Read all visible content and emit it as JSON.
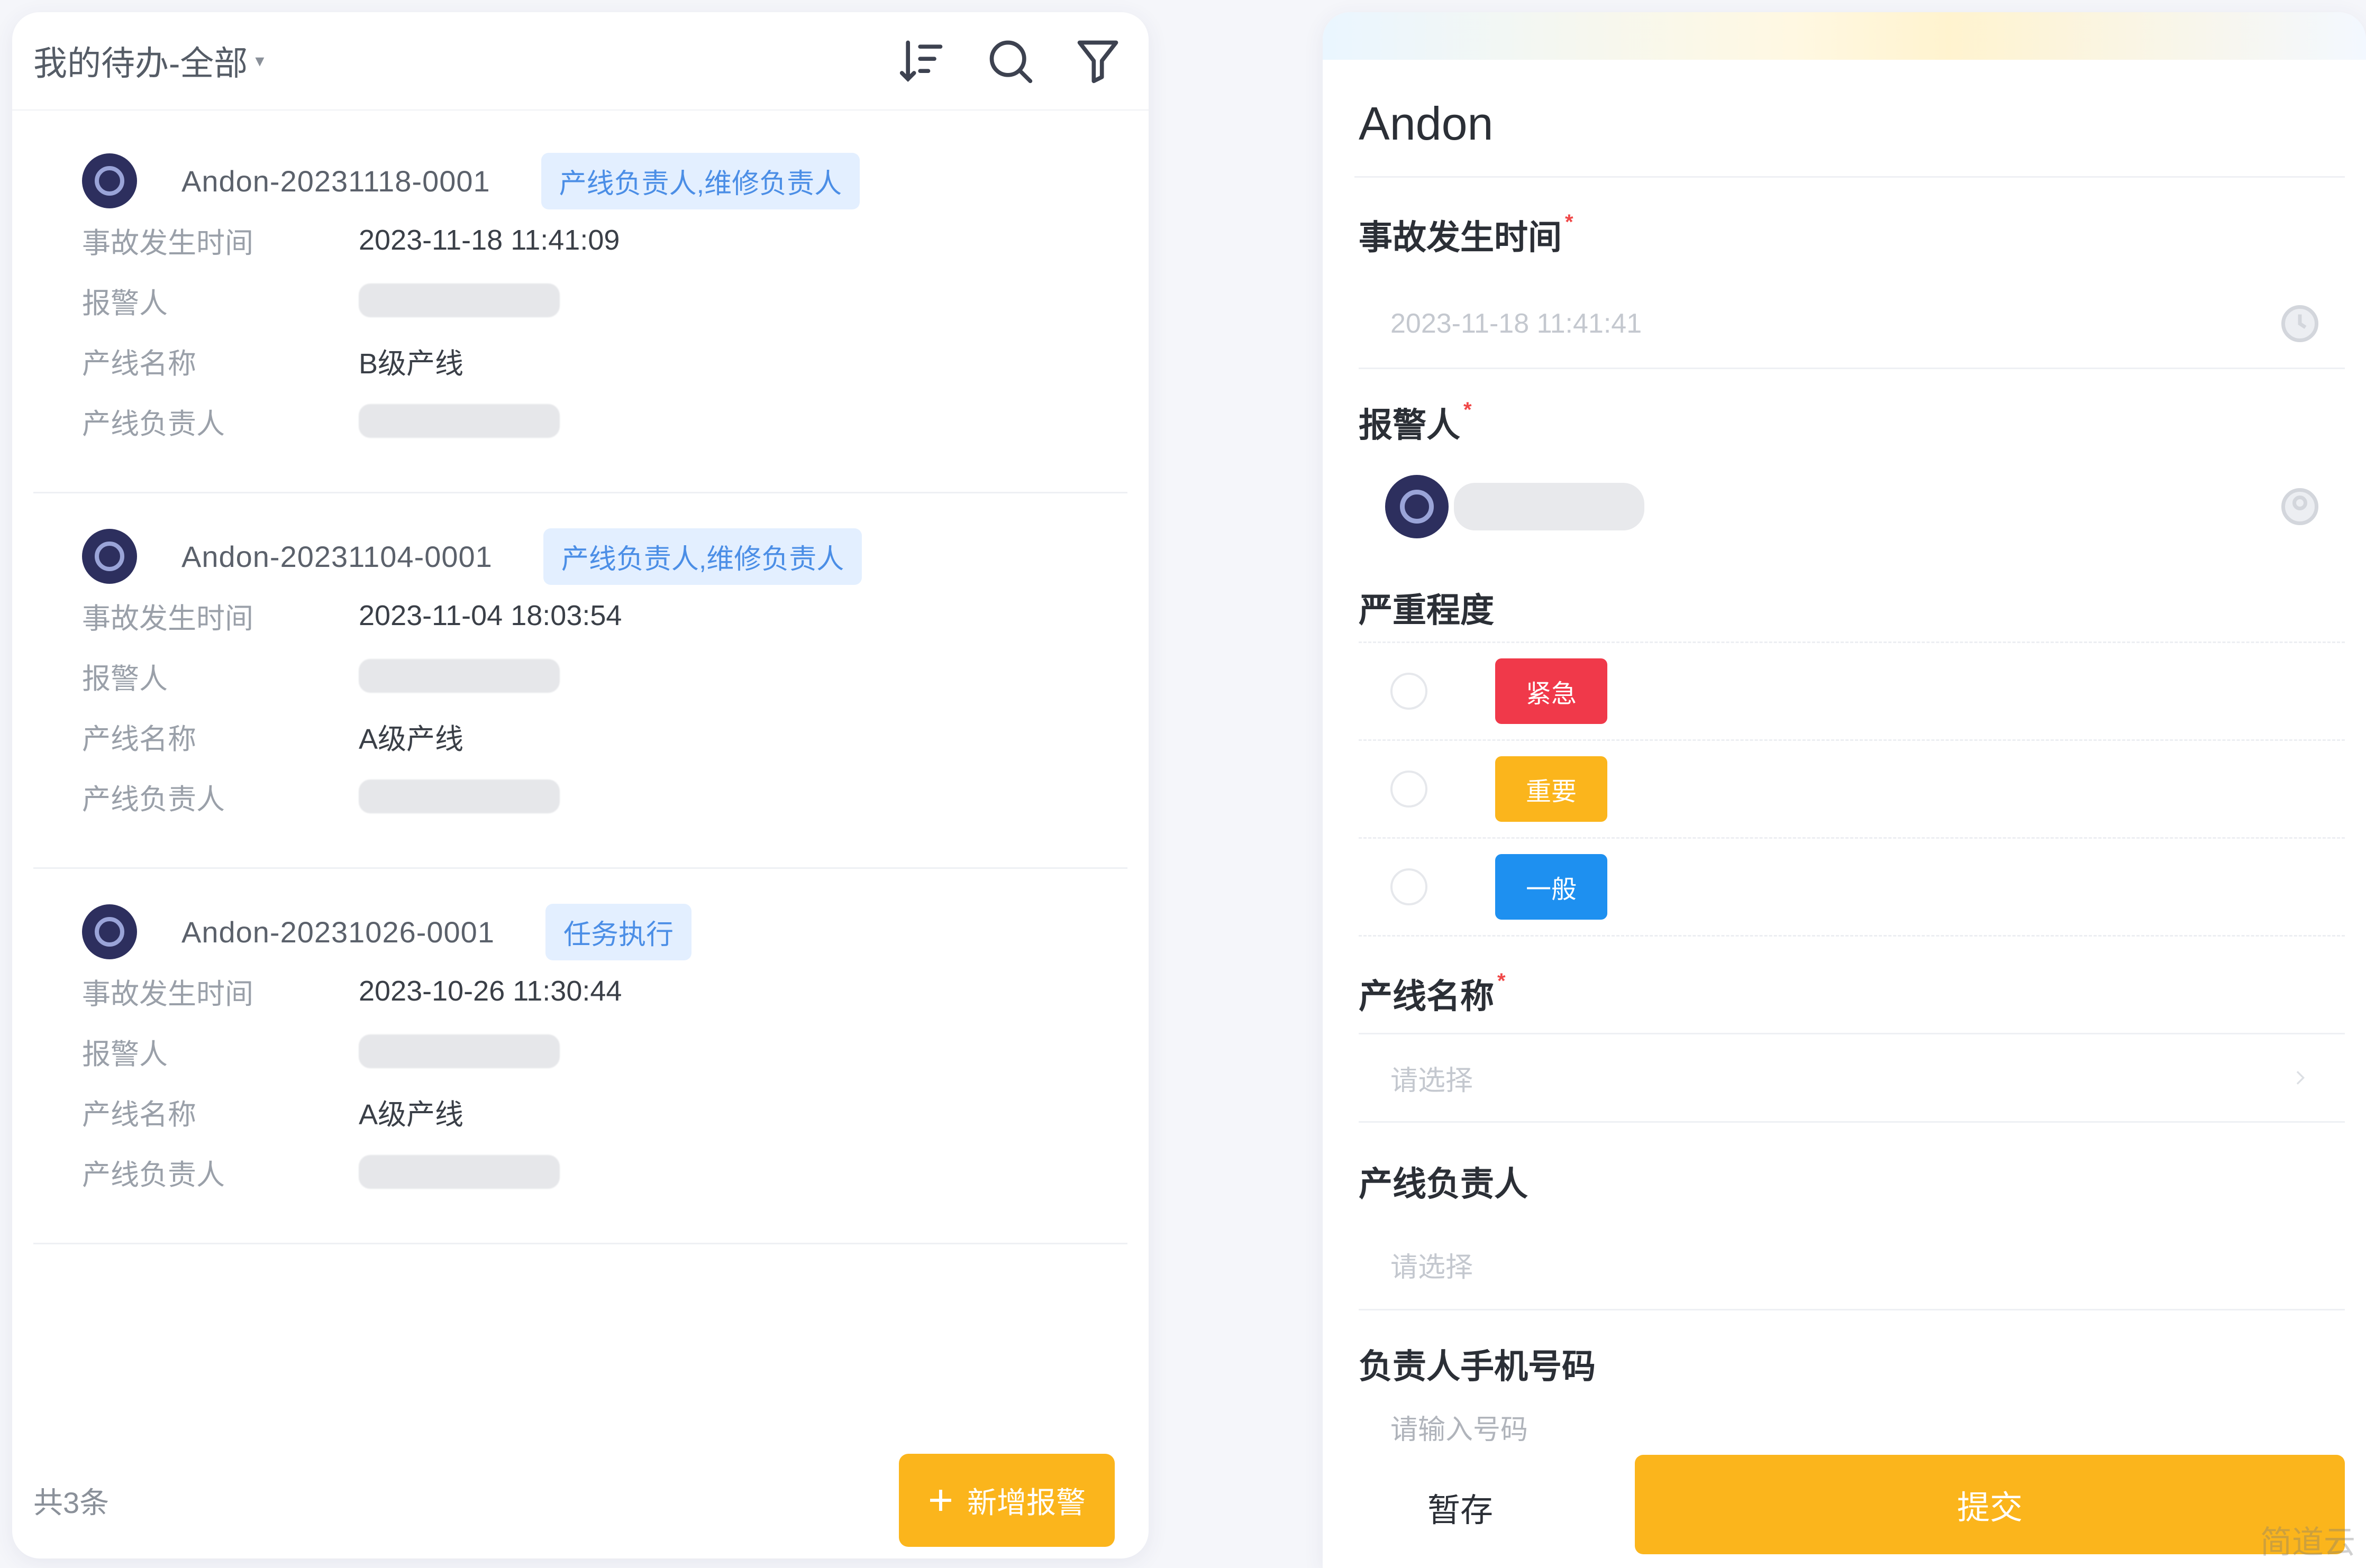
{
  "list_panel": {
    "filter_label": "我的待办-全部",
    "filter_caret": "▾",
    "icons": [
      "sort-icon",
      "search-icon",
      "filter-icon"
    ],
    "field_labels": {
      "time": "事故发生时间",
      "reporter": "报警人",
      "line": "产线名称",
      "owner": "产线负责人"
    },
    "records": [
      {
        "id": "Andon-20231118-0001",
        "status": "产线负责人,维修负责人",
        "time": "2023-11-18 11:41:09",
        "reporter": "",
        "line": "B级产线",
        "owner": ""
      },
      {
        "id": "Andon-20231104-0001",
        "status": "产线负责人,维修负责人",
        "time": "2023-11-04 18:03:54",
        "reporter": "",
        "line": "A级产线",
        "owner": ""
      },
      {
        "id": "Andon-20231026-0001",
        "status": "任务执行",
        "time": "2023-10-26 11:30:44",
        "reporter": "",
        "line": "A级产线",
        "owner": ""
      }
    ],
    "total": "共3条",
    "add_button": {
      "icon": "plus-icon",
      "plus": "+",
      "label": "新增报警"
    }
  },
  "form_panel": {
    "title": "Andon",
    "required_mark": "*",
    "time_field": {
      "label": "事故发生时间",
      "placeholder": "2023-11-18 11:41:41"
    },
    "reporter_field": {
      "label": "报警人"
    },
    "severity_field": {
      "label": "严重程度",
      "options": [
        {
          "label": "紧急",
          "color": "#f0394a"
        },
        {
          "label": "重要",
          "color": "#fbb51c"
        },
        {
          "label": "一般",
          "color": "#1e90f0"
        }
      ]
    },
    "line_field": {
      "label": "产线名称",
      "placeholder": "请选择"
    },
    "owner_field": {
      "label": "产线负责人",
      "placeholder": "请选择"
    },
    "phone_field": {
      "label": "负责人手机号码",
      "placeholder": "请输入号码"
    },
    "temp_save_label": "暂存",
    "submit_label": "提交"
  },
  "watermark": "简道云",
  "colors": {
    "accent": "#fbb51c",
    "avatar_bg": "#2d2f5e",
    "tag_bg": "#e3efff",
    "tag_text": "#4b8ee6"
  }
}
